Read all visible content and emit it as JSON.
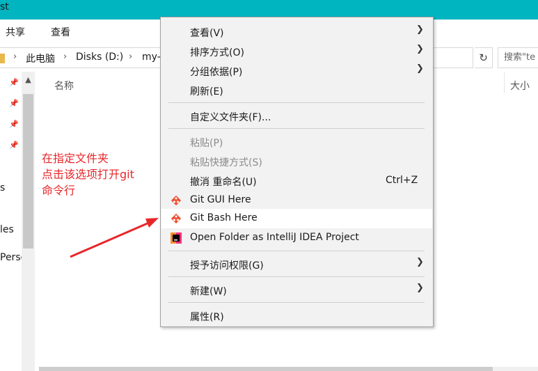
{
  "window": {
    "title_fragment": "st"
  },
  "ribbon": {
    "tabs": [
      "共享",
      "查看"
    ]
  },
  "address": {
    "crumbs": [
      "此电脑",
      "Disks (D:)",
      "my-"
    ],
    "search_placeholder": "搜索\"te"
  },
  "nav": {
    "partial_items": [
      "s",
      "les",
      "Perso"
    ]
  },
  "columns": {
    "name": "名称",
    "size": "大小"
  },
  "annotation": {
    "lines": [
      "在指定文件夹",
      "点击该选项打开git",
      "命令行"
    ],
    "color": "#e8262a"
  },
  "context_menu": {
    "view": "查看(V)",
    "sort": "排序方式(O)",
    "group": "分组依据(P)",
    "refresh": "刷新(E)",
    "customize": "自定义文件夹(F)...",
    "paste": "粘贴(P)",
    "paste_shortcut": "粘贴快捷方式(S)",
    "undo": "撤消 重命名(U)",
    "undo_shortcut": "Ctrl+Z",
    "git_gui": "Git GUI Here",
    "git_bash": "Git Bash Here",
    "intellij": "Open Folder as IntelliJ IDEA Project",
    "grant_access": "授予访问权限(G)",
    "new": "新建(W)",
    "properties": "属性(R)",
    "highlighted_item": "Git Bash Here"
  },
  "colors": {
    "titlebar": "#00b4c0",
    "menu_bg": "#f2f2f2",
    "git": "#f05032"
  }
}
